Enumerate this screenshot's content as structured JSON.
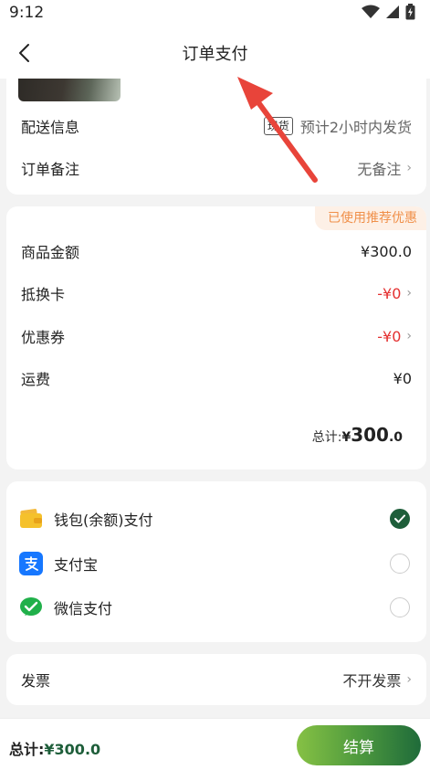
{
  "status_bar": {
    "time": "9:12"
  },
  "nav": {
    "title": "订单支付"
  },
  "shipping": {
    "delivery_label": "配送信息",
    "delivery_tag": "现货",
    "delivery_value": "预计2小时内发货",
    "remark_label": "订单备注",
    "remark_value": "无备注"
  },
  "price_summary": {
    "promo_badge": "已使用推荐优惠",
    "rows": [
      {
        "label": "商品金额",
        "value": "¥300.0"
      },
      {
        "label": "抵换卡",
        "value": "-¥0"
      },
      {
        "label": "优惠券",
        "value": "-¥0"
      },
      {
        "label": "运费",
        "value": "¥0"
      }
    ],
    "total_label": "总计:",
    "total_currency": "¥",
    "total_main": "300",
    "total_decimal": ".0"
  },
  "payment": {
    "methods": [
      {
        "label": "钱包(余额)支付",
        "icon": "wallet-icon",
        "selected": true
      },
      {
        "label": "支付宝",
        "icon": "alipay-icon",
        "selected": false
      },
      {
        "label": "微信支付",
        "icon": "wechat-icon",
        "selected": false
      }
    ]
  },
  "invoice": {
    "label": "发票",
    "value": "不开发票"
  },
  "bottom": {
    "total_label": "总计:",
    "total_amount": "¥300.0",
    "checkout_label": "结算"
  },
  "colors": {
    "accent": "#1e5e3a",
    "promo": "#f0904a",
    "discount": "#e43030"
  }
}
